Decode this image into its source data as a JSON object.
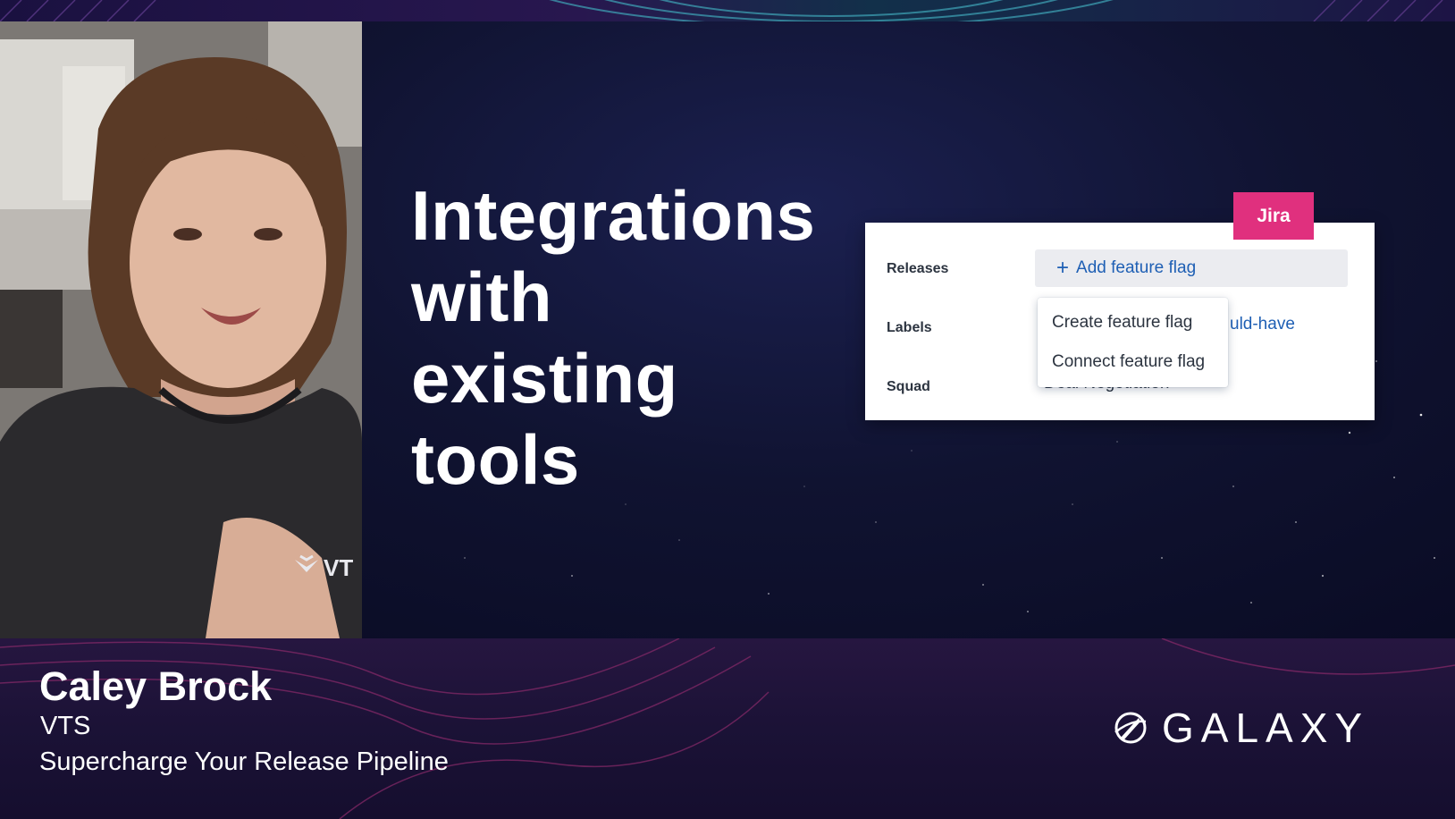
{
  "slide": {
    "headline_lines": [
      "Integrations",
      "with",
      "existing",
      "tools"
    ]
  },
  "jira_panel": {
    "badge": "Jira",
    "releases_label": "Releases",
    "add_flag_label": "Add feature flag",
    "labels_label": "Labels",
    "labels_value_partial": "uld-have",
    "squad_label": "Squad",
    "squad_value_partial": "Deal Negotiation",
    "dropdown_items": [
      "Create feature flag",
      "Connect feature flag"
    ]
  },
  "webcam": {
    "shirt_logo_text": "VT"
  },
  "lower_third": {
    "speaker_name": "Caley Brock",
    "company": "VTS",
    "talk_title": "Supercharge Your Release Pipeline"
  },
  "brand": {
    "logo_text": "GALAXY"
  },
  "colors": {
    "jira_badge": "#e0307e",
    "link_blue": "#1e5fb4",
    "background_navy": "#0c0d2b"
  }
}
